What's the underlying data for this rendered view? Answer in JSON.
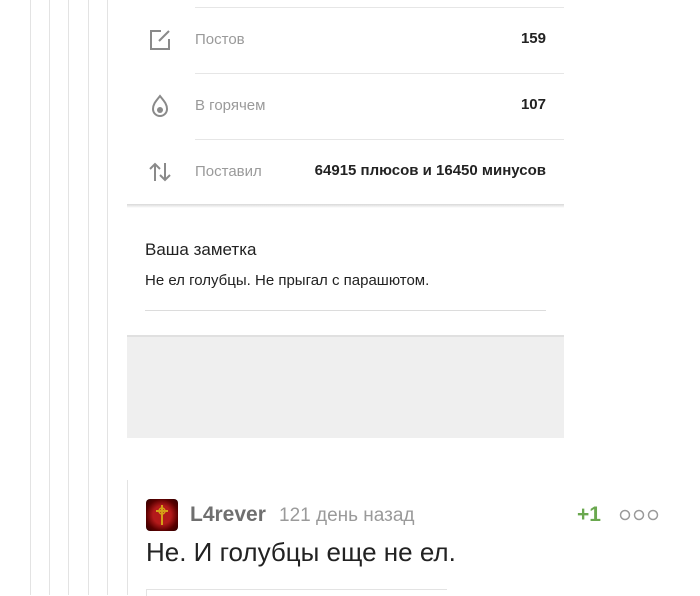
{
  "profile_stats": {
    "posts": {
      "label": "Постов",
      "value": "159",
      "icon": "edit-icon"
    },
    "hot": {
      "label": "В горячем",
      "value": "107",
      "icon": "flame-icon"
    },
    "rated": {
      "label": "Поставил",
      "value": "64915 плюсов и 16450 минусов",
      "icon": "arrows-up-down-icon"
    }
  },
  "note": {
    "title": "Ваша заметка",
    "text": "Не ел голубцы. Не прыгал с парашютом."
  },
  "comment": {
    "author": "L4rever",
    "time": "121 день назад",
    "rating": "+1",
    "text": "Не. И голубцы еще не ел."
  },
  "colors": {
    "rating_positive": "#6aa84f",
    "muted_text": "#9a9a9a"
  }
}
